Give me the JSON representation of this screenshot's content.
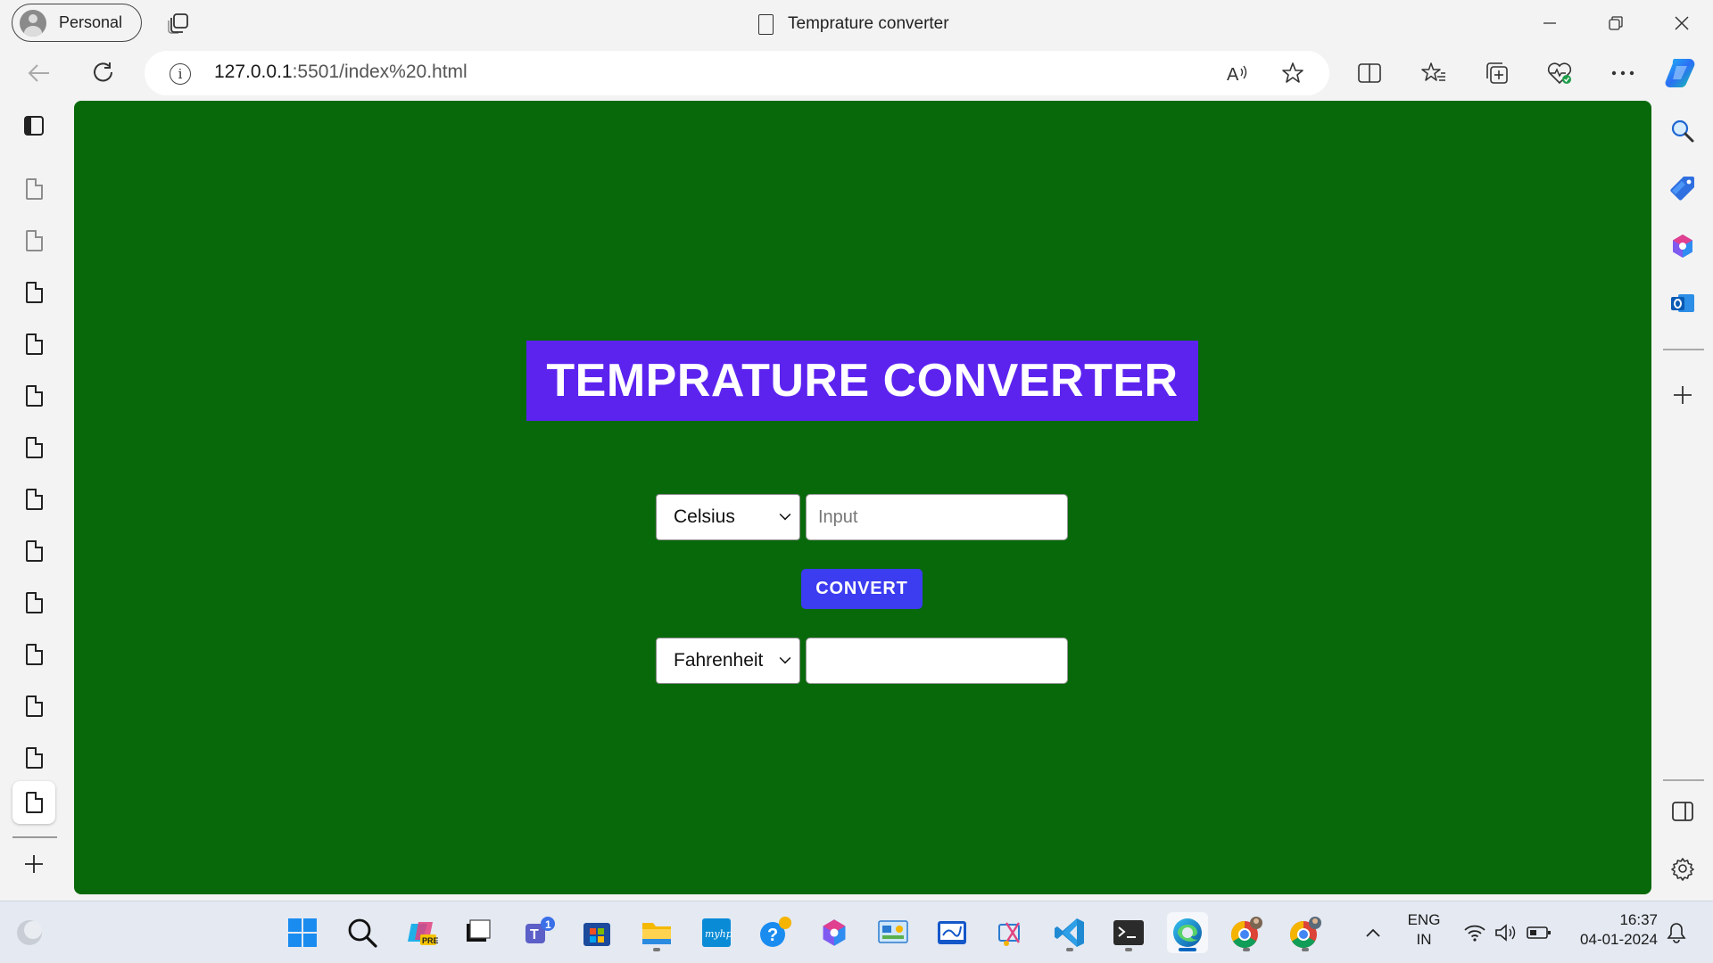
{
  "browser": {
    "profile_label": "Personal",
    "tab_title": "Temprature converter",
    "url_host": "127.0.0.1",
    "url_rest": ":5501/index%20.html"
  },
  "page": {
    "heading": "TEMPRATURE CONVERTER",
    "from_unit": "Celsius",
    "input_placeholder": "Input",
    "convert_label": "CONVERT",
    "to_unit": "Fahrenheit",
    "output_value": ""
  },
  "taskbar": {
    "lang_top": "ENG",
    "lang_bottom": "IN",
    "time": "16:37",
    "date": "04-01-2024",
    "teams_badge": "1"
  },
  "icons": {
    "left_sidebar": [
      "sidebar-toggle-icon",
      "document-icon"
    ],
    "right_sidebar": [
      "search-icon",
      "shopping-tag-icon",
      "copilot-icon",
      "outlook-icon",
      "add-icon",
      "split-panel-icon",
      "settings-icon"
    ]
  }
}
